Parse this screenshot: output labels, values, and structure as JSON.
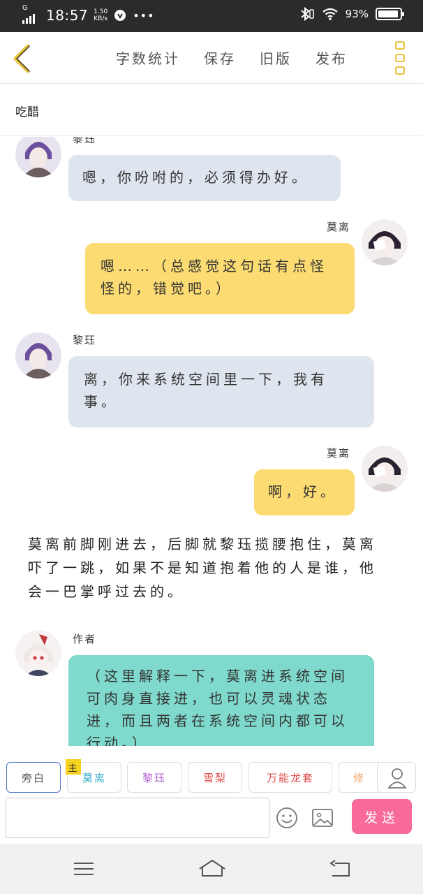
{
  "status_bar": {
    "network": "G",
    "time": "18:57",
    "speed_value": "1.50",
    "speed_unit": "KB/s",
    "battery": "93%"
  },
  "toolbar": {
    "actions": [
      "字数统计",
      "保存",
      "旧版",
      "发布"
    ]
  },
  "story": {
    "title": "吃醋"
  },
  "messages": {
    "m1": {
      "speaker": "黎珏",
      "text": "嗯，你吩咐的，必须得办好。"
    },
    "m2": {
      "speaker": "莫离",
      "text": "嗯……（总感觉这句话有点怪怪的，错觉吧。）"
    },
    "m3": {
      "speaker": "黎珏",
      "text": "离，你来系统空间里一下，我有事。"
    },
    "m4": {
      "speaker": "莫离",
      "text": "啊，好。"
    },
    "narration": "莫离前脚刚进去，后脚就黎珏揽腰抱住，莫离吓了一跳，如果不是知道抱着他的人是谁，他会一巴掌呼过去的。",
    "m5": {
      "speaker": "作者",
      "text": "（这里解释一下，莫离进系统空间可肉身直接进，也可以灵魂状态进，而且两者在系统空间内都可以行动。）"
    }
  },
  "roles": {
    "items": [
      "旁白",
      "莫离",
      "黎珏",
      "雪梨",
      "万能龙套",
      "修"
    ],
    "main_badge": "主",
    "colors": [
      "#555555",
      "#3aaecb",
      "#b060d0",
      "#e24a4a",
      "#e24a4a",
      "#f0a060"
    ]
  },
  "composer": {
    "send_label": "发送",
    "text_value": ""
  },
  "accent": {
    "yellow": "#fcdc72",
    "gray": "#dfe5ee",
    "teal": "#7fd9cc",
    "pink": "#f86a9a"
  }
}
